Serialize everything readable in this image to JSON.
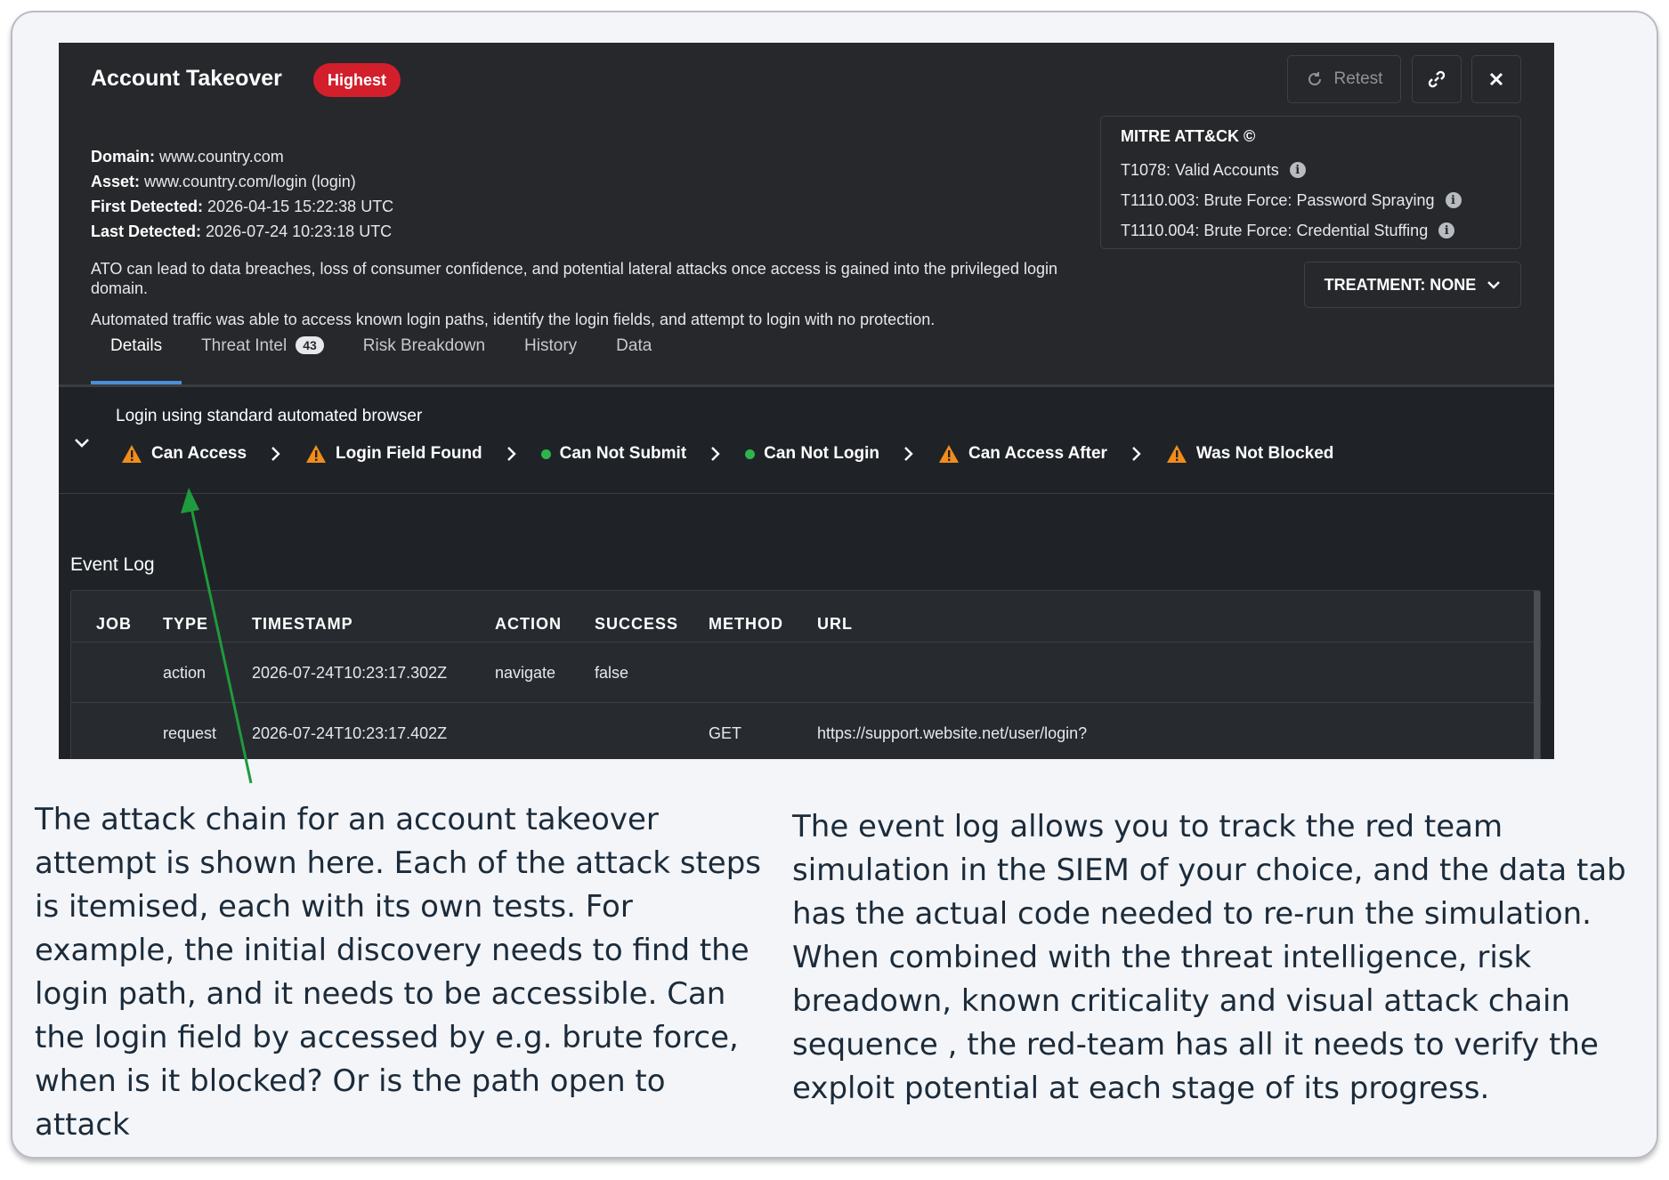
{
  "header": {
    "title": "Account Takeover",
    "severity": "Highest",
    "retest_label": "Retest"
  },
  "meta": {
    "domain_label": "Domain:",
    "domain": "www.country.com",
    "asset_label": "Asset:",
    "asset": "www.country.com/login (login)",
    "first_label": "First Detected:",
    "first": "2026-04-15 15:22:38 UTC",
    "last_label": "Last Detected:",
    "last": "2026-07-24 10:23:18 UTC",
    "desc1": "ATO can lead to data breaches, loss of consumer confidence, and potential lateral attacks once access is gained into the privileged login domain.",
    "desc2": "Automated traffic was able to access known login paths, identify the login fields, and attempt to login with no protection."
  },
  "mitre": {
    "title": "MITRE ATT&CK ©",
    "items": [
      "T1078: Valid Accounts",
      "T1110.003: Brute Force: Password Spraying",
      "T1110.004: Brute Force: Credential Stuffing"
    ]
  },
  "treatment": "TREATMENT: NONE",
  "tabs": [
    {
      "label": "Details"
    },
    {
      "label": "Threat Intel",
      "count": "43"
    },
    {
      "label": "Risk Breakdown"
    },
    {
      "label": "History"
    },
    {
      "label": "Data"
    }
  ],
  "chain": {
    "label": "Login using standard automated browser",
    "steps": [
      {
        "label": "Can Access",
        "status": "warning"
      },
      {
        "label": "Login Field Found",
        "status": "warning"
      },
      {
        "label": "Can Not Submit",
        "status": "ok"
      },
      {
        "label": "Can Not Login",
        "status": "ok"
      },
      {
        "label": "Can Access After",
        "status": "warning"
      },
      {
        "label": "Was Not Blocked",
        "status": "warning"
      }
    ]
  },
  "event_log": {
    "title": "Event Log",
    "columns": [
      "JOB",
      "TYPE",
      "TIMESTAMP",
      "ACTION",
      "SUCCESS",
      "METHOD",
      "URL"
    ],
    "rows": [
      {
        "job": "",
        "type": "action",
        "timestamp": "2026-07-24T10:23:17.302Z",
        "action": "navigate",
        "success": "false",
        "method": "",
        "url": ""
      },
      {
        "job": "",
        "type": "request",
        "timestamp": "2026-07-24T10:23:17.402Z",
        "action": "",
        "success": "",
        "method": "GET",
        "url": "https://support.website.net/user/login?"
      }
    ]
  },
  "colors": {
    "severity": "#d31f2b",
    "warning": "#f28c1a",
    "ok": "#2db54b",
    "annotation_arrow": "#1f9a3c"
  },
  "captions": {
    "left": "The attack chain for an account takeover attempt is shown here. Each of the attack steps is itemised, each with its own tests. For example, the initial discovery needs to find the login path, and it needs to be accessible. Can the login field by accessed by e.g. brute force, when is it blocked? Or is the path open to attack",
    "right": "The event log allows you to track the red team simulation in the SIEM of your choice, and the data tab has the actual code needed to re-run the simulation. When combined with the threat intelligence, risk breadown, known criticality and visual attack chain sequence , the red-team has all it needs to verify the exploit potential at each stage of its progress."
  }
}
